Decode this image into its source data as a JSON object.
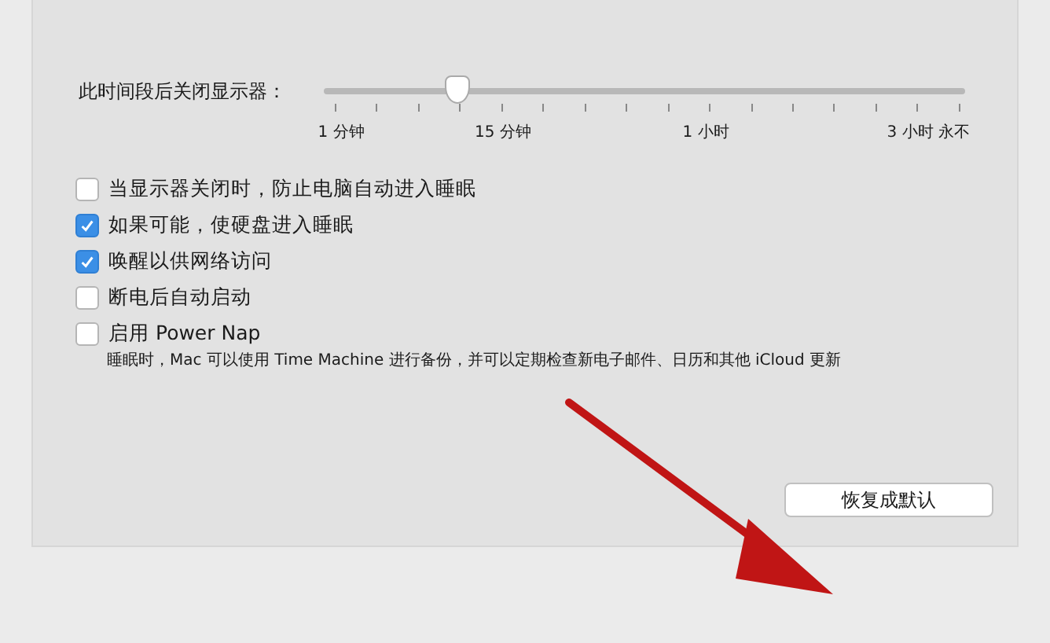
{
  "display_sleep": {
    "label": "此时间段后关闭显示器：",
    "level": 0.208,
    "tick_labels": [
      "1 分钟",
      "15 分钟",
      "1 小时",
      "3 小时",
      "永不"
    ]
  },
  "options": [
    {
      "label": "当显示器关闭时，防止电脑自动进入睡眠",
      "checked": false
    },
    {
      "label": "如果可能，使硬盘进入睡眠",
      "checked": true
    },
    {
      "label": "唤醒以供网络访问",
      "checked": true
    },
    {
      "label": "断电后自动启动",
      "checked": false
    },
    {
      "label": "启用 Power Nap",
      "checked": false,
      "description": "睡眠时，Mac 可以使用 Time Machine 进行备份，并可以定期检查新电子邮件、日历和其他 iCloud 更新"
    }
  ],
  "buttons": [
    "恢复成默认"
  ]
}
